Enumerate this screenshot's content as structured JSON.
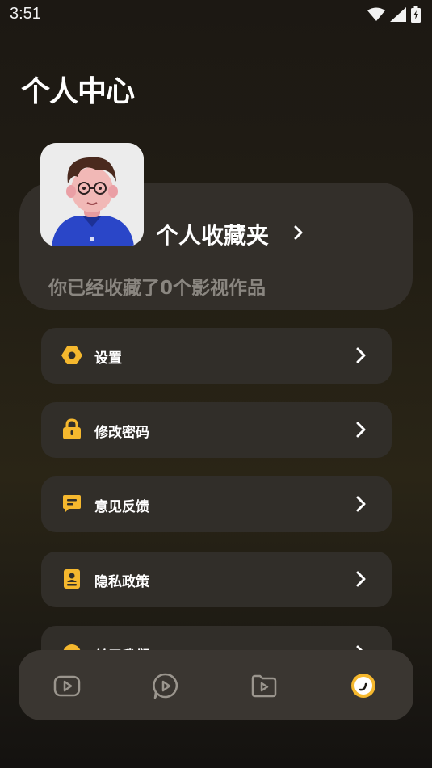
{
  "status": {
    "time": "3:51"
  },
  "header": {
    "title": "个人中心"
  },
  "favorites": {
    "title": "个人收藏夹",
    "subtitle": "你已经收藏了0个影视作品"
  },
  "menu": [
    {
      "label": "设置",
      "icon": "gear-icon"
    },
    {
      "label": "修改密码",
      "icon": "lock-icon"
    },
    {
      "label": "意见反馈",
      "icon": "feedback-icon"
    },
    {
      "label": "隐私政策",
      "icon": "privacy-icon"
    },
    {
      "label": "关于我们",
      "icon": "about-icon"
    }
  ],
  "bottom_nav": [
    {
      "name": "home",
      "icon": "video-play-icon",
      "active": false
    },
    {
      "name": "discover",
      "icon": "chat-play-icon",
      "active": false
    },
    {
      "name": "library",
      "icon": "folder-play-icon",
      "active": false
    },
    {
      "name": "profile",
      "icon": "profile-icon",
      "active": true
    }
  ],
  "colors": {
    "accent": "#f5b82e",
    "card": "#312e29",
    "muted": "#8a8680"
  }
}
